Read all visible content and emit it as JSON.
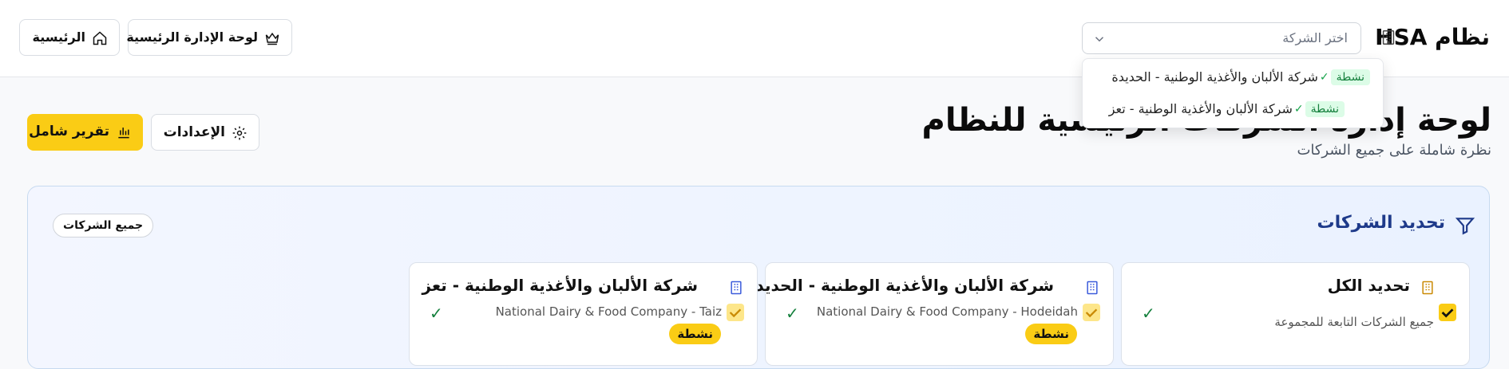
{
  "header": {
    "brand": "نظام HSA",
    "company_select_placeholder": "اختر الشركة",
    "dashboard_label": "لوحة الإدارة الرئيسية",
    "home_label": "الرئيسية"
  },
  "dropdown": {
    "options": [
      {
        "badge": "نشطة",
        "check": "✓",
        "label": "شركة الألبان والأغذية الوطنية - الحديدة"
      },
      {
        "badge": "نشطة",
        "check": "✓",
        "label": "شركة الألبان والأغذية الوطنية - تعز"
      }
    ]
  },
  "page": {
    "title": "لوحة إدارة الشركات الرئيسية للنظام",
    "subtitle": "نظرة شاملة على جميع الشركات",
    "settings_label": "الإعدادات",
    "report_label": "تقرير شامل"
  },
  "selection": {
    "title": "تحديد الشركات",
    "all_companies_pill": "جميع الشركات",
    "cards": [
      {
        "name": "تحديد الكل",
        "subtitle": "جميع الشركات التابعة للمجموعة",
        "check": "✓"
      },
      {
        "name": "شركة الألبان والأغذية الوطنية - الحديدة",
        "subtitle": "National Dairy & Food Company - Hodeidah",
        "badge": "نشطة",
        "check": "✓"
      },
      {
        "name": "شركة الألبان والأغذية الوطنية - تعز",
        "subtitle": "National Dairy & Food Company - Taiz",
        "badge": "نشطة",
        "check": "✓"
      }
    ]
  },
  "colors": {
    "accent": "#facc15",
    "active_badge_bg": "#dcfce7",
    "active_badge_text": "#15803d",
    "panel_title": "#1e3a8a"
  }
}
